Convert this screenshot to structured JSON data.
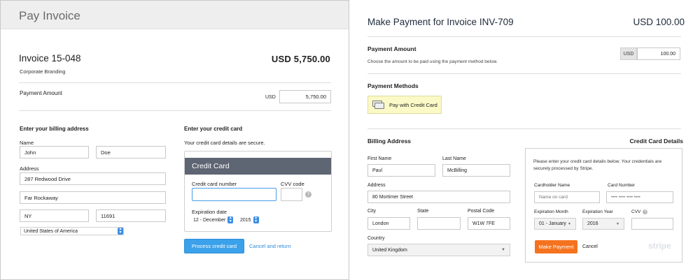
{
  "left": {
    "header_title": "Pay Invoice",
    "invoice_title": "Invoice 15-048",
    "invoice_subtitle": "Corporate Branding",
    "invoice_amount": "USD 5,750.00",
    "payment_amount_label": "Payment Amount",
    "currency": "USD",
    "payment_amount_value": "5,750.00",
    "billing_heading": "Enter your billing address",
    "name_label": "Name",
    "first_name": "John",
    "last_name": "Doe",
    "address_label": "Address",
    "address_line1": "287 Redwood Drive",
    "address_line2": "Far Rockaway",
    "state": "NY",
    "zip": "11691",
    "country": "United States of America",
    "cc_heading": "Enter your credit card",
    "cc_secure_note": "Your credit card details are secure.",
    "cc_box_title": "Credit Card",
    "cc_number_label": "Credit card number",
    "cvv_label": "CVV code",
    "expiration_label": "Expiration date",
    "exp_month": "12 - December",
    "exp_year": "2015",
    "process_button": "Process credit card",
    "cancel_link": "Cancel and return",
    "help_glyph": "?"
  },
  "right": {
    "title": "Make Payment for Invoice INV-709",
    "amount": "USD 100.00",
    "payment_amount_label": "Payment Amount",
    "payment_amount_hint": "Choose the amount to be paid using the payment method below.",
    "currency": "USD",
    "payment_amount_value": "100.00",
    "payment_methods_label": "Payment Methods",
    "pay_cc_button": "Pay with Credit Card",
    "billing_heading": "Billing Address",
    "cc_details_heading": "Credit Card Details",
    "first_name_label": "First Name",
    "last_name_label": "Last Name",
    "first_name": "Paul",
    "last_name": "McBilling",
    "address_label": "Address",
    "address": "80 Mortimer Street",
    "city_label": "City",
    "state_label": "State",
    "postal_label": "Postal Code",
    "city": "London",
    "state": "",
    "postal": "W1W 7FE",
    "country_label": "Country",
    "country": "United Kingdom",
    "stripe_note": "Please enter your credit card details below. Your credentials are securely processed by Stripe.",
    "cardholder_label": "Cardholder Name",
    "cardholder_placeholder": "Name on card",
    "card_number_label": "Card Number",
    "card_number_placeholder": "•••• •••• •••• ••••",
    "exp_month_label": "Expiration Month",
    "exp_year_label": "Expiration Year",
    "cvv_label": "CVV",
    "exp_month": "01 - January",
    "exp_year": "2016",
    "make_payment_button": "Make Payment",
    "cancel_link": "Cancel",
    "stripe_logo": "stripe"
  }
}
